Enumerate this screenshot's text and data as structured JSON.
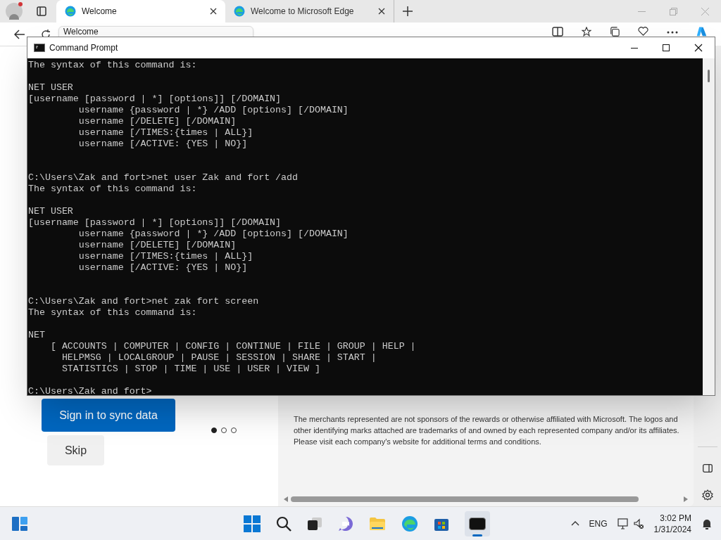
{
  "browser": {
    "tabs": [
      {
        "label": "Welcome",
        "selected": true
      },
      {
        "label": "Welcome to Microsoft Edge",
        "selected": false
      }
    ],
    "tooltip": "Welcome"
  },
  "cmd": {
    "title": "Command Prompt",
    "lines": [
      {
        "kind": "text",
        "text": "The syntax of this command is:"
      },
      {
        "kind": "blank"
      },
      {
        "kind": "text",
        "text": "NET USER"
      },
      {
        "kind": "text",
        "text": "[username [password | *] [options]] [/DOMAIN]"
      },
      {
        "kind": "text",
        "text": "         username {password | *} /ADD [options] [/DOMAIN]"
      },
      {
        "kind": "text",
        "text": "         username [/DELETE] [/DOMAIN]"
      },
      {
        "kind": "text",
        "text": "         username [/TIMES:{times | ALL}]"
      },
      {
        "kind": "text",
        "text": "         username [/ACTIVE: {YES | NO}]"
      },
      {
        "kind": "blank"
      },
      {
        "kind": "blank"
      },
      {
        "kind": "text",
        "text": "C:\\Users\\Zak and fort>net user Zak and fort /add"
      },
      {
        "kind": "text",
        "text": "The syntax of this command is:"
      },
      {
        "kind": "blank"
      },
      {
        "kind": "text",
        "text": "NET USER"
      },
      {
        "kind": "text",
        "text": "[username [password | *] [options]] [/DOMAIN]"
      },
      {
        "kind": "text",
        "text": "         username {password | *} /ADD [options] [/DOMAIN]"
      },
      {
        "kind": "text",
        "text": "         username [/DELETE] [/DOMAIN]"
      },
      {
        "kind": "text",
        "text": "         username [/TIMES:{times | ALL}]"
      },
      {
        "kind": "text",
        "text": "         username [/ACTIVE: {YES | NO}]"
      },
      {
        "kind": "blank"
      },
      {
        "kind": "blank"
      },
      {
        "kind": "text",
        "text": "C:\\Users\\Zak and fort>net zak fort screen"
      },
      {
        "kind": "text",
        "text": "The syntax of this command is:"
      },
      {
        "kind": "blank"
      },
      {
        "kind": "text",
        "text": "NET"
      },
      {
        "kind": "text",
        "text": "    [ ACCOUNTS | COMPUTER | CONFIG | CONTINUE | FILE | GROUP | HELP |"
      },
      {
        "kind": "text",
        "text": "      HELPMSG | LOCALGROUP | PAUSE | SESSION | SHARE | START |"
      },
      {
        "kind": "text",
        "text": "      STATISTICS | STOP | TIME | USE | USER | VIEW ]"
      },
      {
        "kind": "blank"
      },
      {
        "kind": "text",
        "text": "C:\\Users\\Zak and fort>"
      }
    ]
  },
  "page": {
    "sign_in_button": "Sign in to sync data",
    "skip_button": "Skip",
    "carousel_dots": [
      {
        "selected": true
      },
      {
        "selected": false
      },
      {
        "selected": false
      }
    ],
    "disclaimer": "The merchants represented are not sponsors of the rewards or otherwise affiliated with Microsoft. The logos and other identifying marks attached are trademarks of and owned by each represented company and/or its affiliates. Please visit each company's website for additional terms and conditions."
  },
  "taskbar": {
    "language": "ENG",
    "time": "3:02 PM",
    "date": "1/31/2024"
  }
}
